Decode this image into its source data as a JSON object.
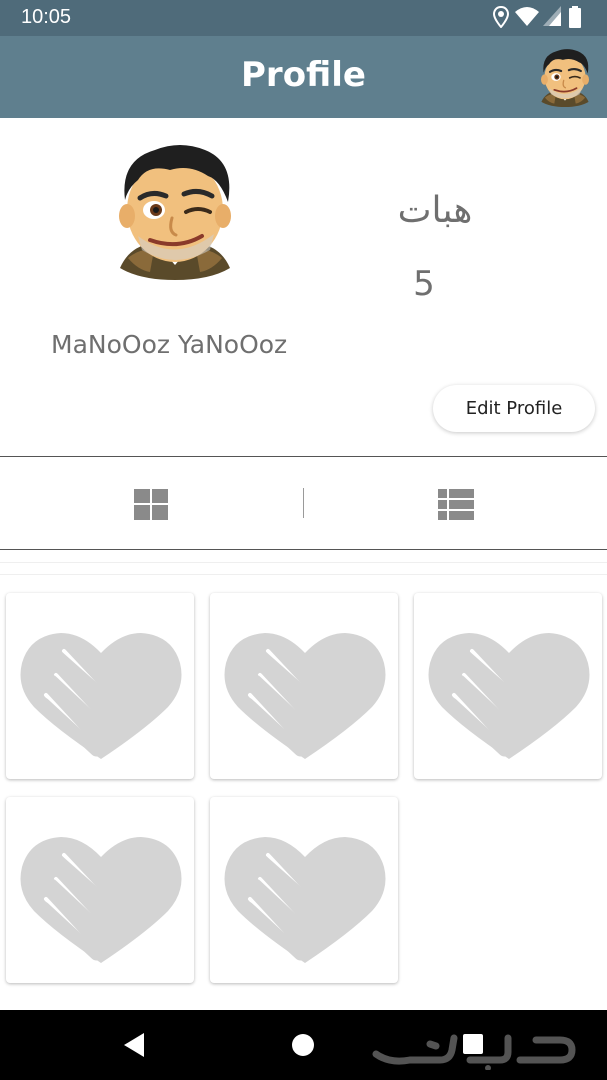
{
  "status_bar": {
    "time": "10:05",
    "icons": [
      "location-icon",
      "wifi-icon",
      "signal-icon",
      "battery-icon"
    ]
  },
  "app_bar": {
    "title": "Profile",
    "background": "#5f7f8e"
  },
  "profile": {
    "name": "MaNoOoz YaNoOoz",
    "stat_label": "هبات",
    "stat_value": "5",
    "edit_button": "Edit Profile"
  },
  "view_tabs": {
    "items": [
      {
        "icon": "grid-view-icon"
      },
      {
        "icon": "list-view-icon"
      }
    ]
  },
  "cards": {
    "count": 5,
    "icon": "heart-handshake-icon"
  },
  "nav_bar": {
    "items": [
      "back-icon",
      "home-icon",
      "recents-icon"
    ],
    "watermark": "حراج"
  },
  "colors": {
    "status_bar": "#4f6b7a",
    "app_bar": "#5f7f8e",
    "text_gray": "#6f6f6f",
    "placeholder_icon": "#d4d4d4"
  }
}
